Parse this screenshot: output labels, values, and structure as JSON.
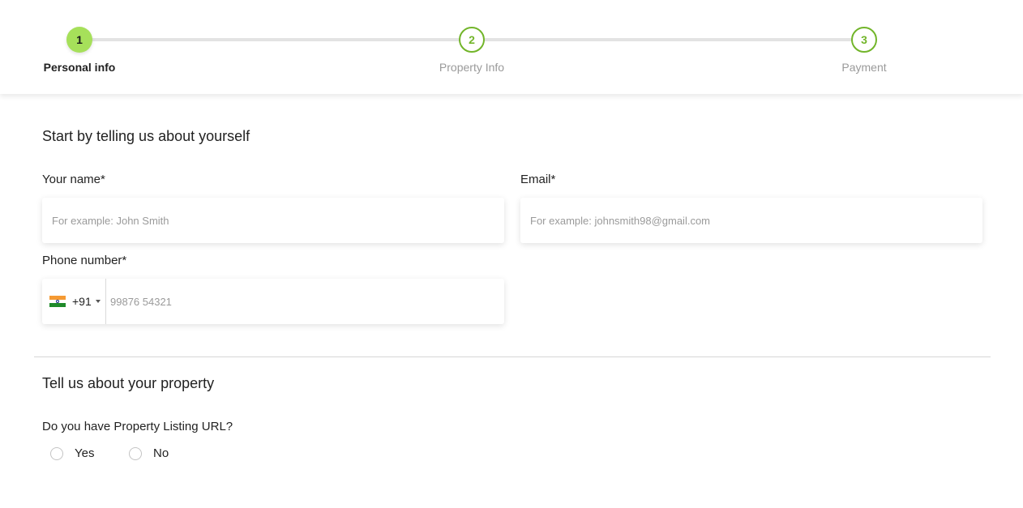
{
  "stepper": {
    "steps": [
      {
        "number": "1",
        "label": "Personal info",
        "state": "active"
      },
      {
        "number": "2",
        "label": "Property Info",
        "state": "pending"
      },
      {
        "number": "3",
        "label": "Payment",
        "state": "pending"
      }
    ]
  },
  "personal": {
    "title": "Start by telling us about yourself",
    "name": {
      "label": "Your name*",
      "placeholder": "For example: John Smith",
      "value": ""
    },
    "email": {
      "label": "Email*",
      "placeholder": "For example: johnsmith98@gmail.com",
      "value": ""
    },
    "phone": {
      "label": "Phone number*",
      "country_code": "+91",
      "country_flag": "india-flag-icon",
      "placeholder": "99876 54321",
      "value": ""
    }
  },
  "property": {
    "title": "Tell us about your property",
    "question": "Do you have Property Listing URL?",
    "options": [
      {
        "label": "Yes",
        "selected": false
      },
      {
        "label": "No",
        "selected": false
      }
    ]
  },
  "colors": {
    "accent_fill": "#a6e05a",
    "accent_outline": "#72b52a",
    "track": "#e3e3e3"
  }
}
